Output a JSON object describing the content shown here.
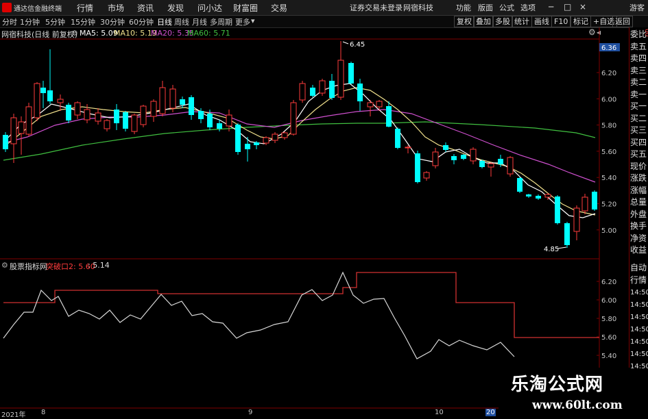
{
  "titlebar": {
    "app_name": "通达信金融终端",
    "menu": [
      "行情",
      "市场",
      "资讯",
      "发现",
      "问小达",
      "财富圈",
      "交易"
    ],
    "notice": "证券交易未登录",
    "stock_label": "网宿科技",
    "right_menu": [
      "功能",
      "版面",
      "公式",
      "选项"
    ],
    "guest": "游客"
  },
  "toolbar": {
    "periods": [
      "分时",
      "1分钟",
      "5分钟",
      "15分钟",
      "30分钟",
      "60分钟",
      "日线",
      "周线",
      "月线",
      "多周期",
      "更多"
    ],
    "active": "日线",
    "right_buttons": [
      "复权",
      "叠加",
      "多股",
      "统计",
      "画线",
      "F10",
      "标记",
      "+自选",
      "返回"
    ]
  },
  "main_chart": {
    "title": "网宿科技(日线 前复权)",
    "ma": [
      {
        "label": "MA5: 5.09",
        "color": "#ffffff"
      },
      {
        "label": "MA10: 5.19",
        "color": "#f0e08c"
      },
      {
        "label": "MA20: 5.35",
        "color": "#d050d0"
      },
      {
        "label": "MA60: 5.71",
        "color": "#40c040"
      }
    ],
    "high_label": "6.45",
    "low_label": "4.85",
    "price_tag": "6.36",
    "yticks": [
      "6.20",
      "6.00",
      "5.80",
      "5.60",
      "5.40",
      "5.20",
      "5.00"
    ]
  },
  "sub_chart": {
    "title": "股票指标网",
    "ind1": "突破口2: 5.60",
    "ind2": ": 5.14",
    "yticks": [
      "6.20",
      "6.00",
      "5.80",
      "5.60",
      "5.40"
    ]
  },
  "dates": [
    "2021年",
    "8",
    "9",
    "10",
    "20"
  ],
  "right_panel": {
    "top_items": [
      "委比",
      "卖五",
      "卖四",
      "卖三",
      "卖二",
      "卖一",
      "买一",
      "买二",
      "买三",
      "买四",
      "买五",
      "现价",
      "涨跌",
      "涨幅",
      "总量",
      "外盘",
      "换手",
      "净资",
      "收益"
    ],
    "bottom_items": [
      "自动",
      "行情",
      "14:50",
      "14:50",
      "14:50",
      "14:50",
      "14:50",
      "14:50",
      "14:50"
    ],
    "side_digits": "00"
  },
  "watermark": {
    "line1": "乐淘公式网",
    "line2": "www.60lt.com"
  },
  "colors": {
    "up": "#ff3c3c",
    "down": "#00ffff",
    "ma5": "#ffffff",
    "ma10": "#f0e08c",
    "ma20": "#d050d0",
    "ma60": "#40c040",
    "frame": "#800000"
  }
}
